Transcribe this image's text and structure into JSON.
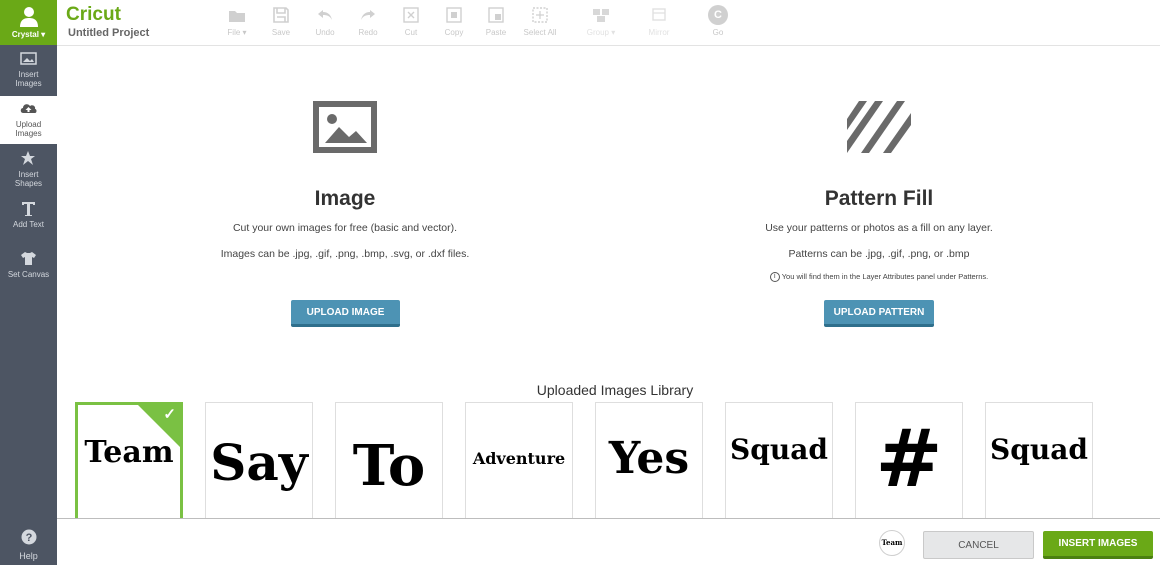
{
  "app": {
    "logo": "Cricut",
    "project_title": "Untitled Project",
    "user_name": "Crystal ▾"
  },
  "sidebar": {
    "items": [
      {
        "label": "Insert Images",
        "icon": "image-icon"
      },
      {
        "label": "Upload Images",
        "icon": "cloud-upload-icon"
      },
      {
        "label": "Insert Shapes",
        "icon": "shapes-icon"
      },
      {
        "label": "Add Text",
        "icon": "text-icon"
      },
      {
        "label": "Set Canvas",
        "icon": "shirt-icon"
      }
    ],
    "help_label": "Help"
  },
  "toolbar": {
    "file": "File ▾",
    "save": "Save",
    "undo": "Undo",
    "redo": "Redo",
    "cut": "Cut",
    "copy": "Copy",
    "paste": "Paste",
    "select_all": "Select All",
    "group": "Group ▾",
    "mirror": "Mirror",
    "go": "Go",
    "go_icon": "C"
  },
  "image_panel": {
    "title": "Image",
    "line1": "Cut your own images for free (basic and vector).",
    "line2": "Images can be .jpg, .gif, .png, .bmp, .svg, or .dxf files.",
    "button": "UPLOAD IMAGE"
  },
  "pattern_panel": {
    "title": "Pattern Fill",
    "line1": "Use your patterns or photos as a fill on any layer.",
    "line2": "Patterns can be .jpg, .gif, .png, or .bmp",
    "note": "You will find them in the Layer Attributes panel under Patterns.",
    "button": "UPLOAD PATTERN"
  },
  "library": {
    "title": "Uploaded Images Library",
    "cards": [
      {
        "text": "Team",
        "selected": true
      },
      {
        "text": "Say",
        "selected": false
      },
      {
        "text": "To",
        "selected": false
      },
      {
        "text": "Adventure",
        "selected": false
      },
      {
        "text": "Yes",
        "selected": false
      },
      {
        "text": "Squad",
        "selected": false
      },
      {
        "text": "#",
        "selected": false
      },
      {
        "text": "Squad",
        "selected": false
      }
    ]
  },
  "bottom": {
    "thumb_text": "Team",
    "cancel": "CANCEL",
    "insert": "INSERT IMAGES"
  },
  "colors": {
    "accent_green": "#6aa917",
    "sidebar_bg": "#4d5563",
    "upload_blue": "#4d93b4"
  }
}
